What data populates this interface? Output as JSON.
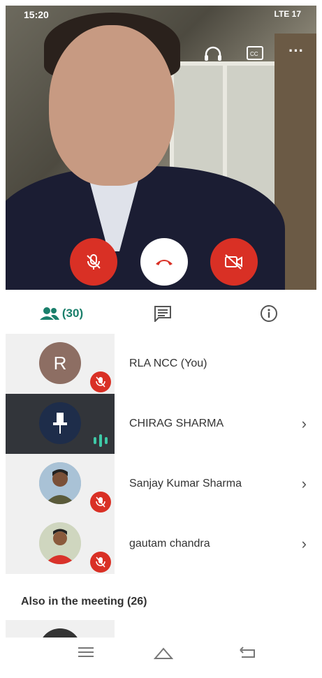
{
  "status_bar": {
    "time": "15:20",
    "right_icons": "LTE 17"
  },
  "call_controls": {
    "mic_state": "muted",
    "hangup_label": "",
    "camera_state": "off"
  },
  "tabs": {
    "people_count": "(30)"
  },
  "participants": [
    {
      "name": "RLA NCC (You)",
      "avatar_letter": "R",
      "muted": true,
      "avatar_color": "#8d6e63"
    },
    {
      "name": "CHIRAG SHARMA",
      "speaking": true
    },
    {
      "name": "Sanjay Kumar Sharma",
      "muted": true
    },
    {
      "name": "gautam chandra",
      "muted": true
    }
  ],
  "also_in_meeting": "Also in the meeting (26)",
  "colors": {
    "accent": "#1a7f6b",
    "danger": "#d93025",
    "speaking": "#3ec9a7"
  }
}
